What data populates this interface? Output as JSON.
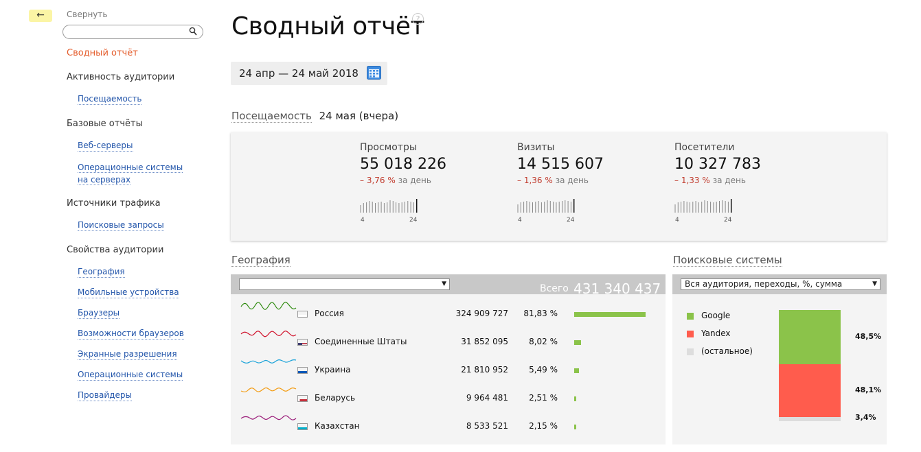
{
  "back_label": "←",
  "sidebar": {
    "collapse_label": "Свернуть",
    "search_placeholder": "",
    "items": [
      {
        "type": "active",
        "label": "Сводный отчёт"
      },
      {
        "type": "section",
        "label": "Активность аудитории"
      },
      {
        "type": "link",
        "label": "Посещаемость"
      },
      {
        "type": "section",
        "label": "Базовые отчёты"
      },
      {
        "type": "link",
        "label": "Веб-серверы"
      },
      {
        "type": "link2",
        "label": "Операционные системы",
        "label2": "на серверах"
      },
      {
        "type": "section",
        "label": "Источники трафика"
      },
      {
        "type": "link",
        "label": "Поисковые запросы"
      },
      {
        "type": "section",
        "label": "Свойства аудитории"
      },
      {
        "type": "link",
        "label": "География"
      },
      {
        "type": "link",
        "label": "Мобильные устройства"
      },
      {
        "type": "link",
        "label": "Браузеры"
      },
      {
        "type": "link",
        "label": "Возможности браузеров"
      },
      {
        "type": "link",
        "label": "Экранные разрешения"
      },
      {
        "type": "link",
        "label": "Операционные системы"
      },
      {
        "type": "link",
        "label": "Провайдеры"
      }
    ]
  },
  "page": {
    "title": "Сводный отчёт",
    "help": "?",
    "date_range": "24 апр — 24 май 2018"
  },
  "visits": {
    "link": "Посещаемость",
    "date": "24 мая (вчера)",
    "stats": [
      {
        "label": "Просмотры",
        "value": "55 018 226",
        "delta": "– 3,76 %",
        "per": "за день",
        "tick_start": "4",
        "tick_end": "24",
        "bars": [
          0.55,
          0.7,
          0.75,
          0.85,
          0.8,
          0.7,
          0.75,
          0.8,
          0.7,
          0.75,
          0.9,
          0.85,
          0.75,
          0.7,
          0.75,
          0.8,
          0.85,
          0.8,
          0.75,
          1.0
        ]
      },
      {
        "label": "Визиты",
        "value": "14 515 607",
        "delta": "– 1,36 %",
        "per": "за день",
        "tick_start": "4",
        "tick_end": "24",
        "bars": [
          0.6,
          0.75,
          0.8,
          0.85,
          0.8,
          0.75,
          0.8,
          0.85,
          0.75,
          0.8,
          0.9,
          0.85,
          0.8,
          0.75,
          0.8,
          0.85,
          0.9,
          0.85,
          0.8,
          1.0
        ]
      },
      {
        "label": "Посетители",
        "value": "10 327 783",
        "delta": "– 1,33 %",
        "per": "за день",
        "tick_start": "4",
        "tick_end": "24",
        "bars": [
          0.6,
          0.75,
          0.8,
          0.85,
          0.8,
          0.75,
          0.8,
          0.85,
          0.75,
          0.8,
          0.9,
          0.85,
          0.8,
          0.75,
          0.8,
          0.85,
          0.9,
          0.85,
          0.8,
          1.0
        ]
      }
    ]
  },
  "geography": {
    "title": "География",
    "select_value": "",
    "total_label": "Всего",
    "total_value": "431 340 437",
    "rows": [
      {
        "country": "Россия",
        "visits": "324 909 727",
        "share_label": "81,83 %",
        "share": 81.83,
        "color": "#2e8b0e",
        "flag": "ru"
      },
      {
        "country": "Соединенные Штаты",
        "visits": "31 852 095",
        "share_label": "8,02 %",
        "share": 8.02,
        "color": "#d0102a",
        "flag": "us"
      },
      {
        "country": "Украина",
        "visits": "21 810 952",
        "share_label": "5,49 %",
        "share": 5.49,
        "color": "#1aa3d9",
        "flag": "ua"
      },
      {
        "country": "Беларусь",
        "visits": "9 964 481",
        "share_label": "2,51 %",
        "share": 2.51,
        "color": "#f39c12",
        "flag": "by"
      },
      {
        "country": "Казахстан",
        "visits": "8 533 521",
        "share_label": "2,15 %",
        "share": 2.15,
        "color": "#9b1d7a",
        "flag": "kz"
      }
    ]
  },
  "search_engines": {
    "title": "Поисковые системы",
    "select_value": "Вся аудитория, переходы, %, сумма",
    "items": [
      {
        "name": "Google",
        "share_label": "48,5%",
        "share": 48.5,
        "color": "#8bc34a"
      },
      {
        "name": "Yandex",
        "share_label": "48,1%",
        "share": 48.1,
        "color": "#ff5c4d"
      },
      {
        "name": "(остальное)",
        "share_label": "3,4%",
        "share": 3.4,
        "color": "#dddddd"
      }
    ]
  }
}
